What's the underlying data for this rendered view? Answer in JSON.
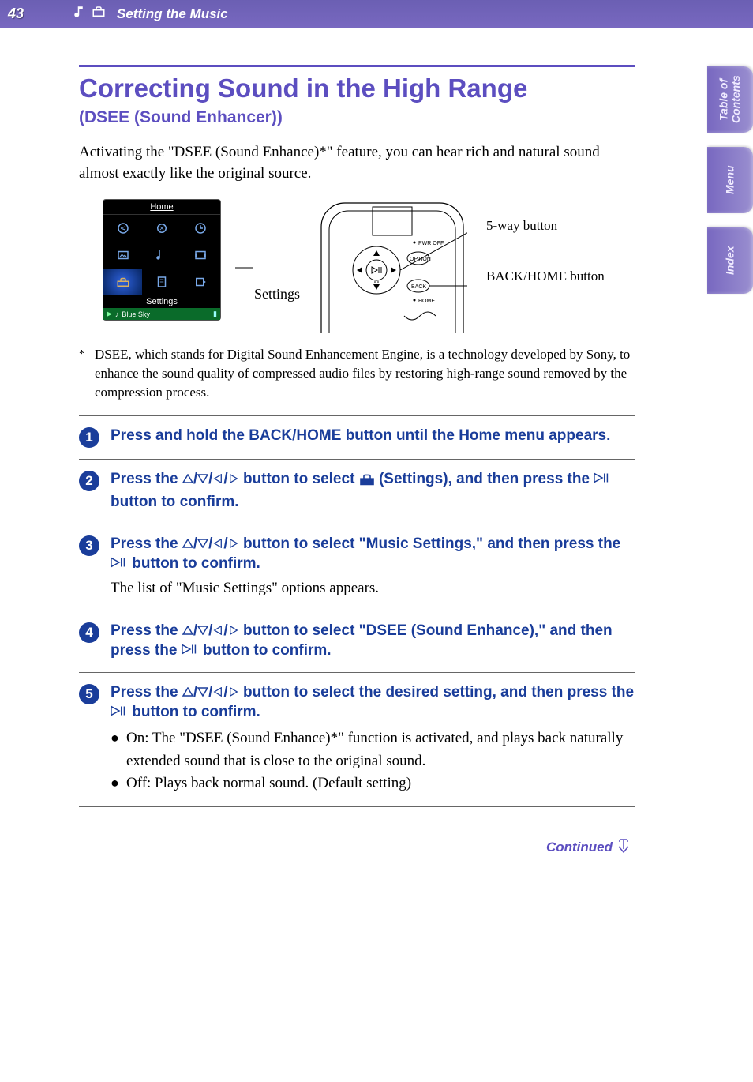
{
  "header": {
    "page_number": "43",
    "breadcrumb": "Setting the Music"
  },
  "side_tabs": {
    "toc": "Table of\nContents",
    "menu": "Menu",
    "index": "Index"
  },
  "main": {
    "title": "Correcting Sound in the High Range",
    "subtitle": "(DSEE (Sound Enhancer))",
    "intro": "Activating the \"DSEE (Sound Enhance)*\" feature, you can hear rich and natural sound almost exactly like the original source.",
    "figure": {
      "home_screen": {
        "title": "Home",
        "selected_label": "Settings",
        "now_playing": "Blue Sky"
      },
      "label_settings": "Settings",
      "callout_5way": "5-way button",
      "callout_backhome": "BACK/HOME button",
      "device_text": {
        "pwroff": "PWR OFF",
        "option": "OPTION",
        "back": "BACK",
        "home": "HOME"
      }
    },
    "footnote_marker": "*",
    "footnote": "DSEE, which stands for Digital Sound Enhancement Engine, is a technology developed by Sony, to enhance the sound quality of compressed audio files by restoring high-range sound removed by the compression process.",
    "steps": [
      {
        "n": "1",
        "heading_parts": {
          "full": "Press and hold the BACK/HOME button until the Home menu appears."
        }
      },
      {
        "n": "2",
        "heading_parts": {
          "a": "Press the ",
          "b": " button to select ",
          "c": " (Settings), and then press the ",
          "d": " button to confirm."
        }
      },
      {
        "n": "3",
        "heading_parts": {
          "a": "Press the ",
          "b": " button to select \"Music Settings,\" and then press the ",
          "c": " button to confirm."
        },
        "body": "The list of \"Music Settings\" options appears."
      },
      {
        "n": "4",
        "heading_parts": {
          "a": "Press the ",
          "b": " button to select \"DSEE (Sound Enhance),\" and then press the ",
          "c": " button to confirm."
        }
      },
      {
        "n": "5",
        "heading_parts": {
          "a": "Press the ",
          "b": " button to select the desired setting, and then press the ",
          "c": " button to confirm."
        },
        "bullets": [
          "On: The \"DSEE (Sound Enhance)*\" function is activated, and plays back naturally extended sound that is close to the original sound.",
          "Off: Plays back normal sound. (Default setting)"
        ]
      }
    ],
    "continued": "Continued"
  }
}
